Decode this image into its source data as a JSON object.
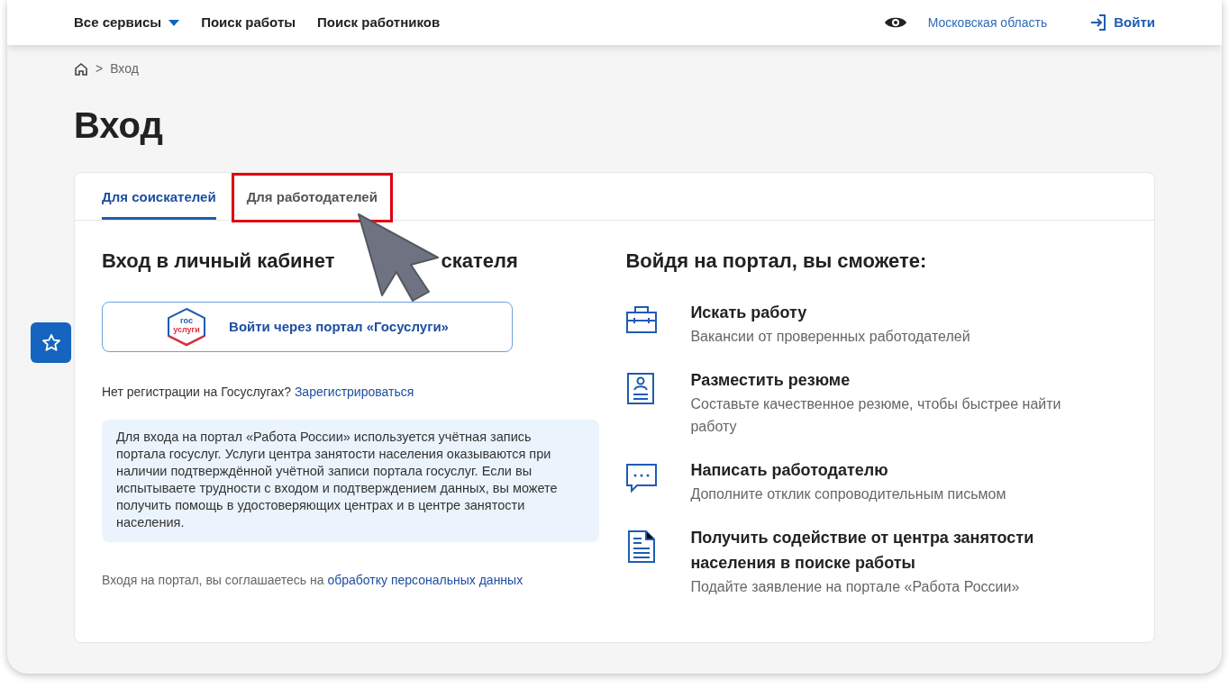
{
  "nav": {
    "services": "Все сервисы",
    "links": [
      "Поиск работы",
      "Поиск работников"
    ],
    "region": "Московская область",
    "login": "Войти"
  },
  "breadcrumb_separator": ">",
  "breadcrumb": [
    "Вход"
  ],
  "title": "Вход",
  "tabs": [
    {
      "label": "Для соискателей",
      "selected": true,
      "highlighted": false
    },
    {
      "label": "Для работодателей",
      "selected": false,
      "highlighted": true
    }
  ],
  "left": {
    "heading_parts": [
      "Вход в личный кабинет",
      "скателя"
    ],
    "gosuslugi_logo": [
      "гос",
      "услуги"
    ],
    "gosuslugi_button": "Войти через портал «Госуслуги»",
    "register_prompt": "Нет регистрации на Госуслугах?",
    "register_link": "Зарегистрироваться",
    "info": "Для входа на портал «Работа России» используется учётная запись портала госуслуг. Услуги центра занятости населения оказываются при наличии подтверждённой учётной записи портала госуслуг. Если вы испытываете трудности с входом и подтверждением данных, вы можете получить помощь в удостоверяющих центрах и в центре занятости населения.",
    "consent": "Входя на портал, вы соглашаетесь на",
    "consent_link": "обработку персональных данных"
  },
  "right": {
    "heading": "Войдя на портал, вы сможете:",
    "features": [
      {
        "kind": "briefcase",
        "title": "Искать работу",
        "text": "Вакансии от проверенных работодателей"
      },
      {
        "kind": "resume",
        "title": "Разместить резюме",
        "text": "Составьте качественное резюме, чтобы быстрее найти работу"
      },
      {
        "kind": "chat",
        "title": "Написать работодателю",
        "text": "Дополните отклик сопроводительным письмом"
      },
      {
        "kind": "document",
        "title": "Получить содействие от центра занятости населения в поиске работы",
        "text": "Подайте заявление на портале «Работа России»"
      }
    ]
  }
}
